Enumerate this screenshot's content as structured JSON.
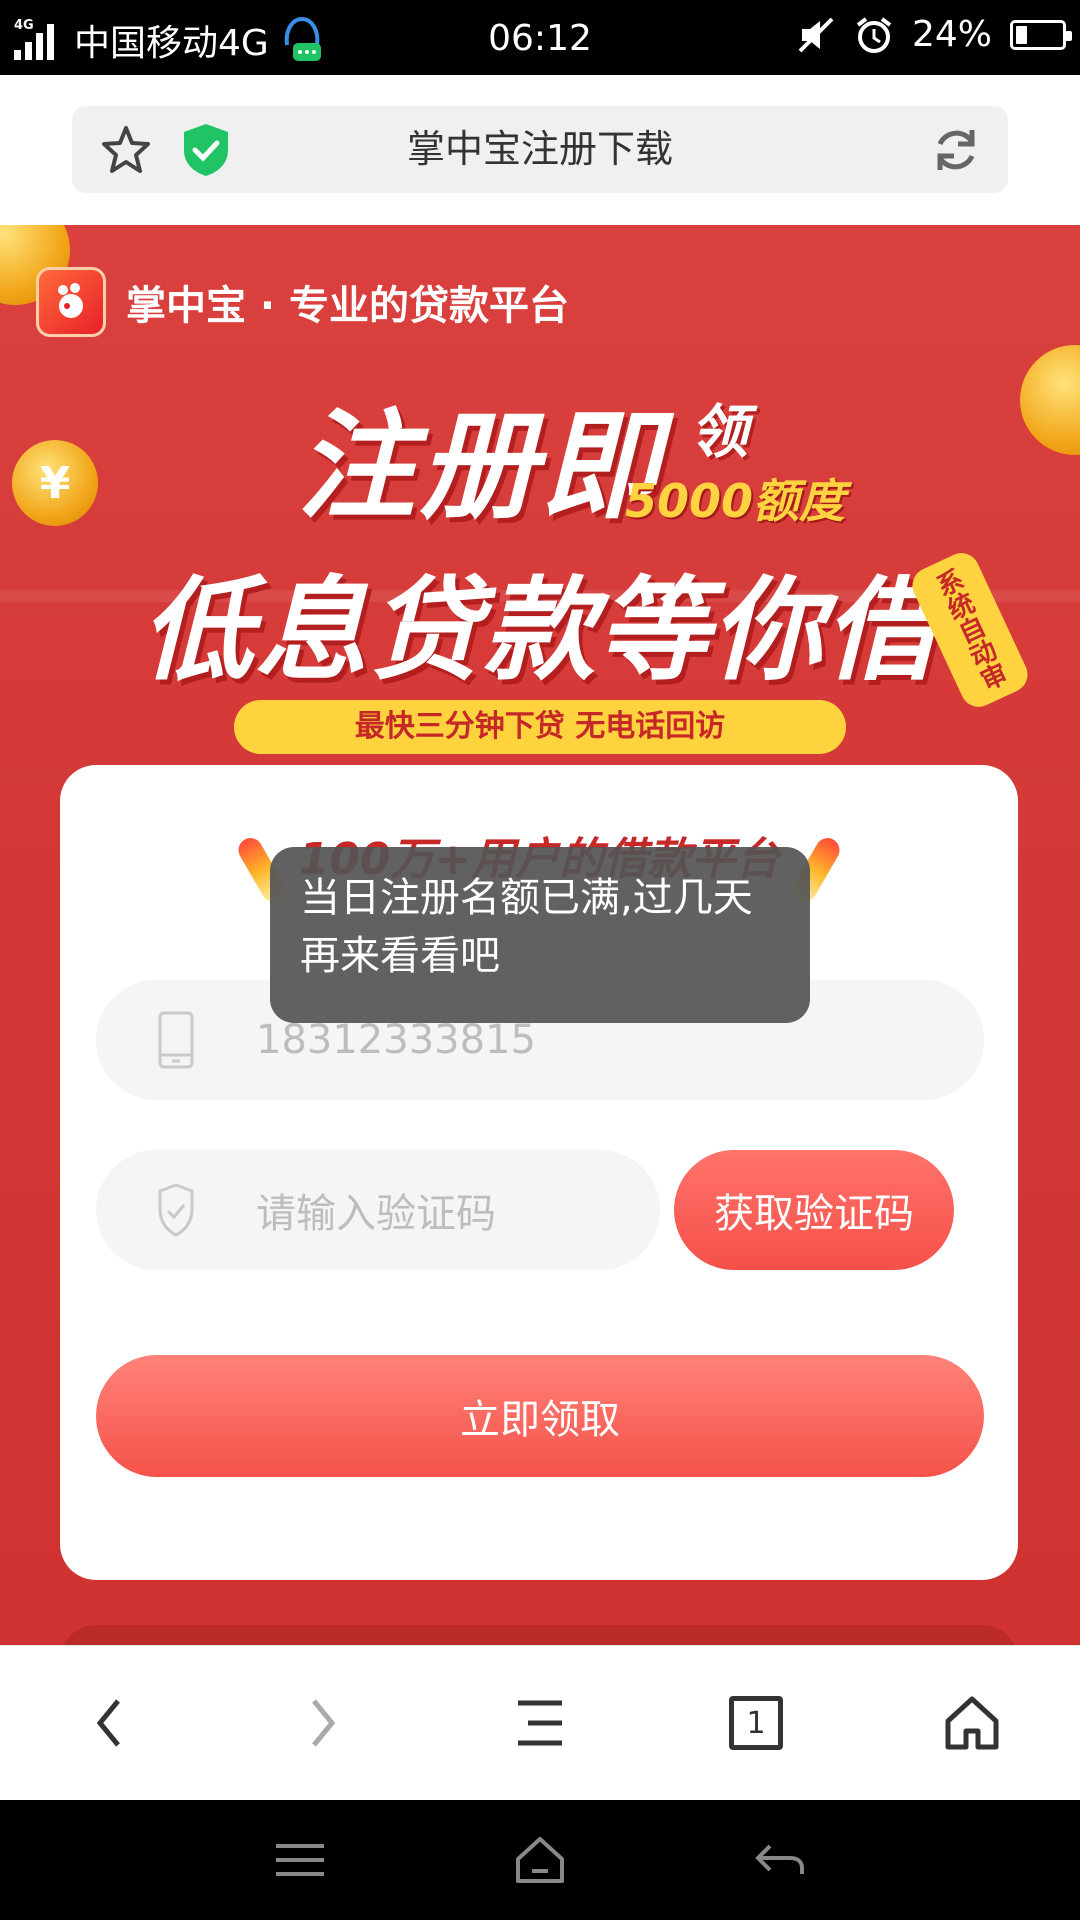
{
  "status_bar": {
    "network_label": "4G",
    "carrier": "中国移动4G",
    "time": "06:12",
    "battery": "24%",
    "battery_level": 0.24
  },
  "address_bar": {
    "title": "掌中宝注册下载"
  },
  "banner": {
    "brand": "掌中宝 · 专业的贷款平台",
    "headline_main": "注册即",
    "headline_ling": "领",
    "headline_quota": "5000额度",
    "headline_second": "低息贷款等你借",
    "auto_tag": "系统自动审",
    "yellow_pill": "最快三分钟下贷   无电话回访",
    "coin_symbol": "¥"
  },
  "form": {
    "title": "100万+用户的借款平台",
    "phone_value": "18312333815",
    "code_placeholder": "请输入验证码",
    "get_code_label": "获取验证码",
    "submit_label": "立即领取"
  },
  "toast": {
    "message": "当日注册名额已满,过几天再来看看吧"
  },
  "toolbar": {
    "tab_count": "1",
    "icons": [
      "back-icon",
      "forward-icon",
      "menu-icon",
      "tabs-icon",
      "home-icon"
    ]
  },
  "colors": {
    "banner_red": "#d9403e",
    "accent_yellow": "#ffd33d",
    "button_red": "#f5504a",
    "shield_green": "#20c464"
  }
}
